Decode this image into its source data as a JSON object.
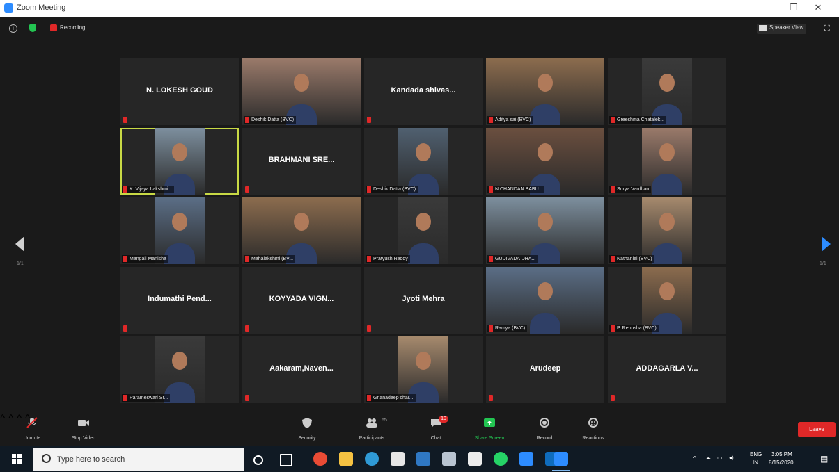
{
  "window": {
    "title": "Zoom Meeting",
    "minimize": "—",
    "maximize": "❐",
    "close": "✕"
  },
  "topbar": {
    "recording_label": "Recording",
    "speaker_view_label": "Speaker View"
  },
  "pager": {
    "left": "1/1",
    "right": "1/1"
  },
  "colors": {
    "accent": "#2d8cff",
    "muted": "#e02828",
    "active_border": "#c8d945",
    "leave": "#e02828",
    "share": "#23c552"
  },
  "participants": [
    {
      "name": "N. LOKESH GOUD",
      "video": false
    },
    {
      "name": "",
      "label": "Deshik Datta (BVC)",
      "video": true
    },
    {
      "name": "Kandada shivas...",
      "video": false
    },
    {
      "name": "",
      "label": "Aditya sai (BVC)",
      "video": true
    },
    {
      "name": "",
      "label": "Greeshma Chatalek...",
      "video": true
    },
    {
      "name": "",
      "label": "K. Vijaya Lakshmi...",
      "video": true,
      "active": true
    },
    {
      "name": "BRAHMANI SRE...",
      "video": false
    },
    {
      "name": "",
      "label": "Deshik Datta (BVC)",
      "video": true
    },
    {
      "name": "",
      "label": "N.CHANDAN BABU...",
      "video": true
    },
    {
      "name": "",
      "label": "Surya Vardhan",
      "video": true
    },
    {
      "name": "",
      "label": "Mangali Manisha",
      "video": true
    },
    {
      "name": "",
      "label": "Mahalakshmi (BV...",
      "video": true
    },
    {
      "name": "",
      "label": "Pratyush Reddy",
      "video": true
    },
    {
      "name": "",
      "label": "GUDIVADA DHA...",
      "video": true
    },
    {
      "name": "",
      "label": "Nathaniel (BVC)",
      "video": true
    },
    {
      "name": "Indumathi Pend...",
      "video": false
    },
    {
      "name": "KOYYADA VIGN...",
      "video": false
    },
    {
      "name": "Jyoti Mehra",
      "video": false
    },
    {
      "name": "",
      "label": "Ramya (BVC)",
      "video": true
    },
    {
      "name": "",
      "label": "P. Renusha (BVC)",
      "video": true
    },
    {
      "name": "",
      "label": "Parameswari Sr...",
      "video": true
    },
    {
      "name": "Aakaram,Naven...",
      "video": false
    },
    {
      "name": "",
      "label": "Gnanadeep char...",
      "video": true
    },
    {
      "name": "Arudeep",
      "video": false
    },
    {
      "name": "ADDAGARLA V...",
      "video": false
    }
  ],
  "toolbar": {
    "unmute": "Unmute",
    "stop_video": "Stop Video",
    "security": "Security",
    "participants": "Participants",
    "participants_count": "65",
    "chat": "Chat",
    "chat_badge": "10",
    "share_screen": "Share Screen",
    "record": "Record",
    "reactions": "Reactions",
    "leave": "Leave"
  },
  "taskbar": {
    "search_placeholder": "Type here to search",
    "lang_top": "ENG",
    "lang_bottom": "IN",
    "time": "3:05 PM",
    "date": "8/15/2020"
  }
}
